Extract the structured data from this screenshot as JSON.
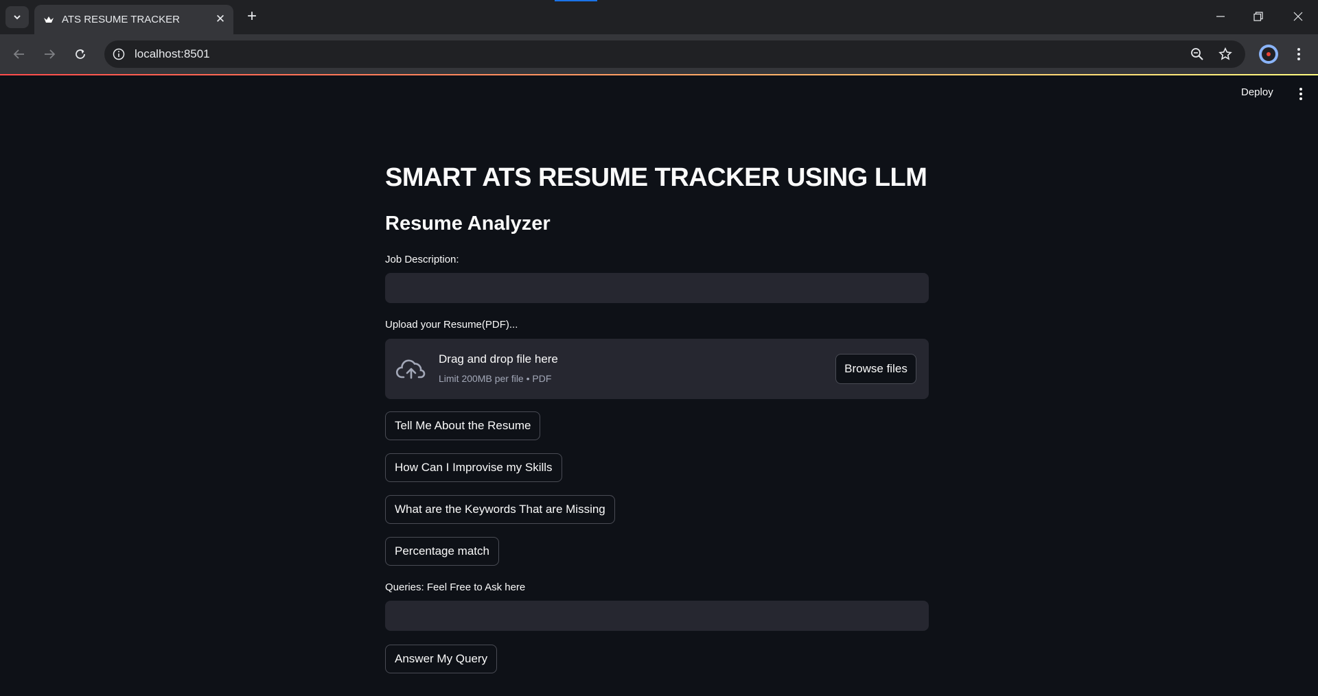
{
  "browser": {
    "tab_title": "ATS RESUME TRACKER",
    "url": "localhost:8501"
  },
  "app_header": {
    "deploy_label": "Deploy"
  },
  "main": {
    "title": "SMART ATS RESUME TRACKER USING LLM",
    "subtitle": "Resume Analyzer",
    "job_description": {
      "label": "Job Description:",
      "value": ""
    },
    "upload": {
      "label": "Upload your Resume(PDF)...",
      "drop_title": "Drag and drop file here",
      "drop_subtitle": "Limit 200MB per file • PDF",
      "browse_label": "Browse files"
    },
    "buttons": [
      "Tell Me About the Resume",
      "How Can I Improvise my Skills",
      "What are the Keywords That are Missing",
      "Percentage match"
    ],
    "query": {
      "label": "Queries: Feel Free to Ask here",
      "value": ""
    },
    "answer_button": "Answer My Query"
  }
}
